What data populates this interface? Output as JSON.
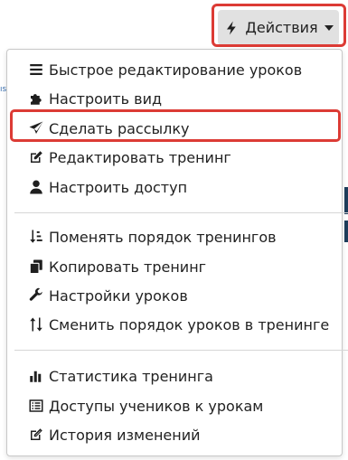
{
  "actions_button": {
    "label": "Действия",
    "icon": "bolt-icon"
  },
  "edge": {
    "left_glyph": "ıs"
  },
  "menu": {
    "groups": [
      [
        {
          "label": "Быстрое редактирование уроков",
          "icon": "list-icon"
        },
        {
          "label": "Настроить вид",
          "icon": "puzzle-icon"
        },
        {
          "label": "Сделать рассылку",
          "icon": "paper-plane-icon"
        },
        {
          "label": "Редактировать тренинг",
          "icon": "edit-icon"
        },
        {
          "label": "Настроить доступ",
          "icon": "user-icon"
        }
      ],
      [
        {
          "label": "Поменять порядок тренингов",
          "icon": "sort-amount-icon"
        },
        {
          "label": "Копировать тренинг",
          "icon": "copy-icon"
        },
        {
          "label": "Настройки уроков",
          "icon": "wrench-icon"
        },
        {
          "label": "Сменить порядок уроков в тренинге",
          "icon": "sort-arrows-icon"
        }
      ],
      [
        {
          "label": "Статистика тренинга",
          "icon": "bar-chart-icon"
        },
        {
          "label": "Доступы учеников к урокам",
          "icon": "list-alt-icon"
        },
        {
          "label": "История изменений",
          "icon": "edit-outline-icon"
        }
      ]
    ]
  },
  "colors": {
    "highlight": "#dc3b35",
    "button_bg": "#e1e1e1"
  }
}
